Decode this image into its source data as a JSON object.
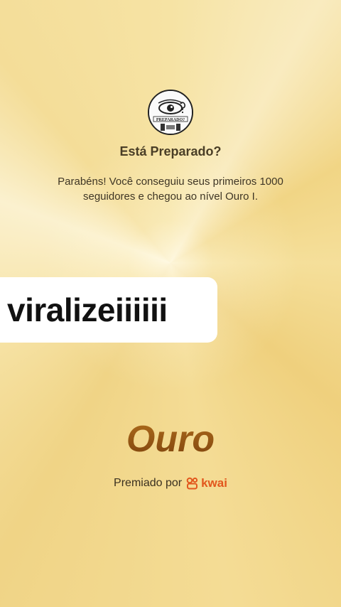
{
  "achievement": {
    "title": "Está Preparado?",
    "message": "Parabéns! Você conseguiu seus primeiros 1000 seguidores e chegou ao nível Ouro I.",
    "avatar_icon": "eye-logo-icon",
    "avatar_text": "PREPARADO?"
  },
  "overlay": {
    "caption": "viralizeiiiiii"
  },
  "level": {
    "name": "Ouro"
  },
  "footer": {
    "awarded_by": "Premiado por",
    "brand": "kwai",
    "brand_icon": "kwai-logo-icon",
    "brand_color": "#e2571d"
  },
  "colors": {
    "background": "#f3d98a",
    "level_text": "#8a4f12"
  }
}
